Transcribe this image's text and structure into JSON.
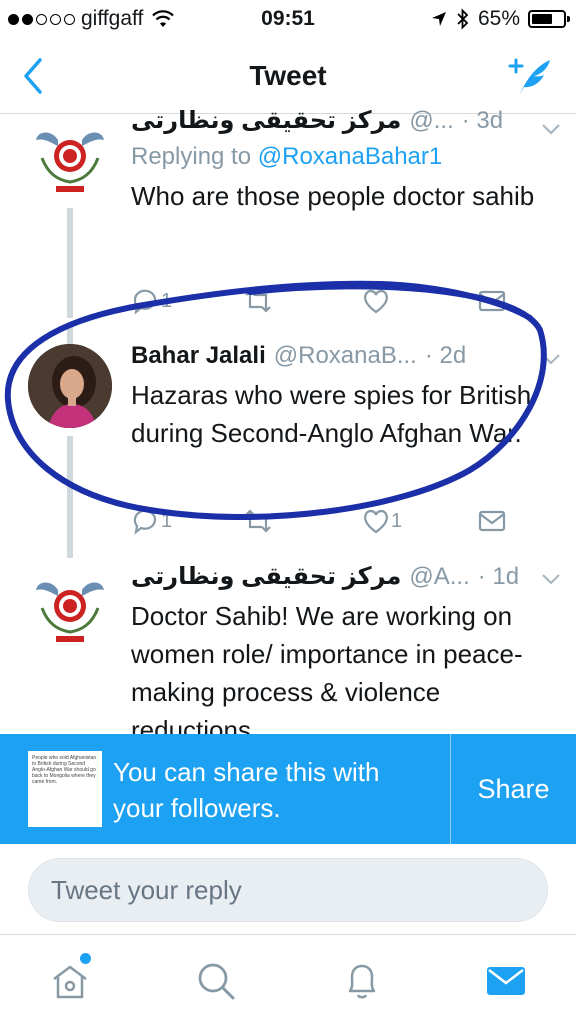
{
  "status_bar": {
    "carrier": "giffgaff",
    "time": "09:51",
    "battery": "65%",
    "battery_level": 0.65
  },
  "nav": {
    "title": "Tweet",
    "back_icon": "chevron-left-icon",
    "compose_icon": "compose-tweet-icon"
  },
  "tweets": [
    {
      "name": "مرکز تحقیقی ونظارتی",
      "handle": "@...",
      "time": "· 3d",
      "replying_prefix": "Replying to ",
      "replying_handle": "@RoxanaBahar1",
      "text": "Who are those people doctor sahib",
      "reply_count": "1"
    },
    {
      "name": "Bahar Jalali",
      "handle": "@RoxanaB...",
      "time": "· 2d",
      "text": "Hazaras who were spies for British during Second-Anglo Afghan War.",
      "reply_count": "1",
      "like_count": "1"
    },
    {
      "name": "مرکز تحقیقی ونظارتی",
      "handle": "@A...",
      "time": "· 1d",
      "text": "Doctor Sahib! We are working on women role/ importance in peace-making process & violence reductions"
    }
  ],
  "share_banner": {
    "thumbnail_text": "People who sold Afghanistan to British during Second Anglo-Afghan War should go back to Mongolia where they came from.",
    "message": "You can share this with your followers.",
    "button": "Share"
  },
  "reply_box": {
    "placeholder": "Tweet your reply"
  },
  "tab_bar": {
    "items": [
      "home-icon",
      "search-icon",
      "notifications-icon",
      "messages-icon"
    ]
  },
  "colors": {
    "accent": "#1da1f2",
    "text": "#14171a",
    "muted": "#8899a6",
    "ink_circle": "#1a2fa8"
  }
}
